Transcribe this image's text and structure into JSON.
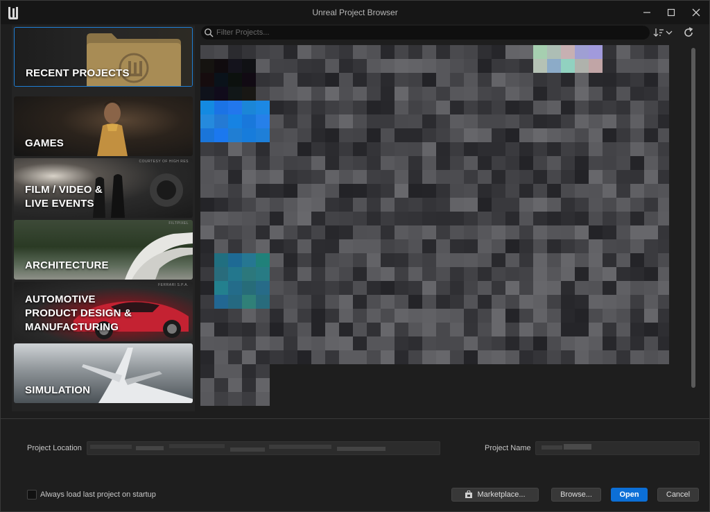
{
  "window": {
    "title": "Unreal Project Browser"
  },
  "categories": [
    {
      "key": "recent",
      "label": "RECENT PROJECTS",
      "selected": true
    },
    {
      "key": "games",
      "label": "GAMES"
    },
    {
      "key": "film",
      "label": "FILM / VIDEO & LIVE EVENTS",
      "credit": "COURTESY OF HIGH RES"
    },
    {
      "key": "architecture",
      "label": "ARCHITECTURE",
      "credit": "FILTPIXEL"
    },
    {
      "key": "automotive",
      "label": "AUTOMOTIVE PRODUCT DESIGN & MANUFACTURING",
      "credit": "FERRARI S.P.A."
    },
    {
      "key": "simulation",
      "label": "SIMULATION"
    }
  ],
  "search": {
    "placeholder": "Filter Projects..."
  },
  "footer": {
    "location_label": "Project Location",
    "name_label": "Project Name",
    "checkbox_label": "Always load last project on startup",
    "marketplace_label": "Marketplace...",
    "browse_label": "Browse...",
    "open_label": "Open",
    "cancel_label": "Cancel"
  },
  "colors": {
    "accent": "#0c6fd6",
    "selection_border": "#1f7fd6",
    "background": "#1e1e1e"
  },
  "icons": {
    "logo": "unreal-logo-icon",
    "search": "search-icon",
    "sort": "sort-icon",
    "refresh": "refresh-icon",
    "marketplace": "marketplace-icon"
  }
}
